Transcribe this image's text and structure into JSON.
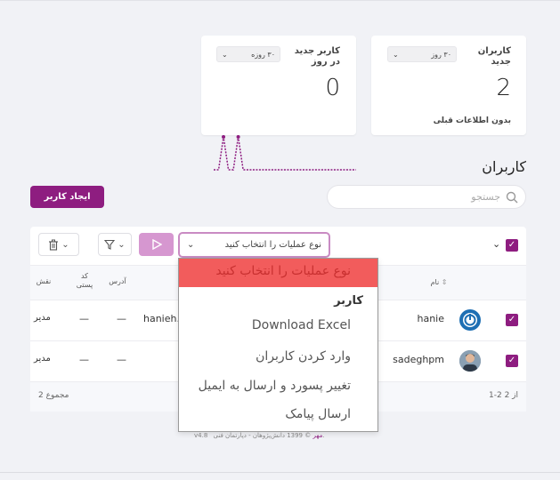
{
  "stats": {
    "users_card": {
      "title": "کاربران جدید",
      "period": "۳۰ روز",
      "value": "2",
      "note": "بدون اطلاعات قبلی"
    },
    "daily_card": {
      "title": "کاربر جدید در روز",
      "period": "۳۰ روزه",
      "value": "0"
    }
  },
  "colors": {
    "accent": "#8e1d80",
    "highlight": "#f25c5c",
    "chart_line": "#8e1d80"
  },
  "section_title": "کاربران",
  "create_button": "ایجاد کاربر",
  "search": {
    "placeholder": "جستجو"
  },
  "toolbar": {
    "bulk_action_placeholder": "نوع عملیات را انتخاب کنید"
  },
  "table": {
    "columns": {
      "name": "نام",
      "address": "آدرس",
      "postal_code": "کد پستی",
      "role": "نقش"
    },
    "rows": [
      {
        "name": "hanie",
        "email": "hanieh.",
        "address": "—",
        "postal": "—",
        "role": "مدیر"
      },
      {
        "name": "sadeghpm",
        "email": "",
        "address": "—",
        "postal": "—",
        "role": "مدیر"
      }
    ],
    "pagination": "1-2 از 2",
    "total": "مجموع 2"
  },
  "dropdown": {
    "placeholder": "نوع عملیات را انتخاب کنید",
    "group": "کاربر",
    "items": [
      "Download Excel",
      "وارد کردن کاربران",
      "تغییر پسورد و ارسال به ایمیل",
      "ارسال پیامک"
    ]
  },
  "footer": {
    "copyright": "© 1399 دانش‌پژوهان - دپارتمان فنی.",
    "brand": "مهر",
    "version": "v4.8"
  },
  "chart_data": {
    "type": "line",
    "x": [
      1,
      2,
      3,
      4,
      5,
      6,
      7,
      8,
      9,
      10,
      11,
      12,
      13,
      14,
      15,
      16,
      17,
      18,
      19,
      20,
      21,
      22,
      23,
      24,
      25,
      26,
      27,
      28,
      29,
      30
    ],
    "series": [
      {
        "values": [
          0,
          0,
          1,
          0,
          0,
          1,
          0,
          0,
          0,
          0,
          0,
          0,
          0,
          0,
          0,
          0,
          0,
          0,
          0,
          0,
          0,
          0,
          0,
          0,
          0,
          0,
          0,
          0,
          0,
          0
        ]
      }
    ],
    "ylim": [
      0,
      1
    ]
  }
}
